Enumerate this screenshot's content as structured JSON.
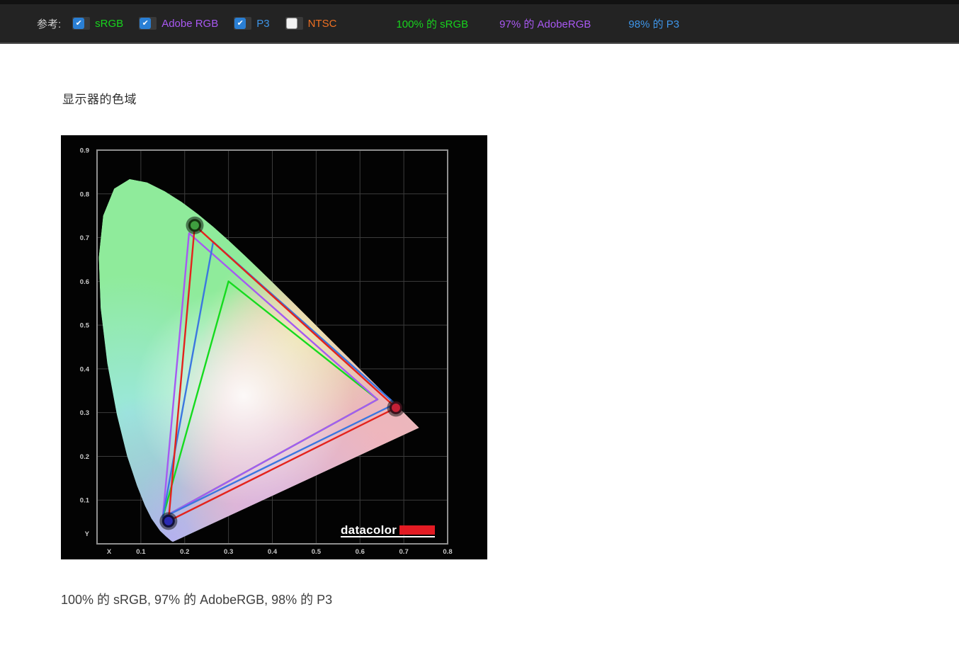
{
  "toolbar": {
    "label": "参考:",
    "checkboxes": [
      {
        "label": "sRGB",
        "checked": true,
        "color": "#17d41d"
      },
      {
        "label": "Adobe RGB",
        "checked": true,
        "color": "#a958f2"
      },
      {
        "label": "P3",
        "checked": true,
        "color": "#3e95e8"
      },
      {
        "label": "NTSC",
        "checked": false,
        "color": "#ee7022"
      }
    ],
    "summaries": [
      {
        "text": "100% 的 sRGB",
        "color": "#17d41d"
      },
      {
        "text": "97% 的 AdobeRGB",
        "color": "#a958f2"
      },
      {
        "text": "98% 的 P3",
        "color": "#3e95e8"
      }
    ]
  },
  "main": {
    "title": "显示器的色域",
    "caption": "100% 的 sRGB, 97% 的 AdobeRGB, 98% 的 P3"
  },
  "chart_data": {
    "type": "scatter",
    "subtype": "cie-1931-chromaticity-diagram",
    "title": "显示器的色域",
    "xlabel": "X",
    "ylabel": "Y",
    "xlim": [
      0,
      0.8
    ],
    "ylim": [
      0,
      0.9
    ],
    "xticks": [
      "0.1",
      "0.2",
      "0.3",
      "0.4",
      "0.5",
      "0.6",
      "0.7",
      "0.8"
    ],
    "yticks": [
      "0.1",
      "0.2",
      "0.3",
      "0.4",
      "0.5",
      "0.6",
      "0.7",
      "0.8",
      "0.9"
    ],
    "grid": true,
    "legend_position": "none",
    "brand": "datacolor",
    "brand_accent_color": "#e31b23",
    "series": [
      {
        "name": "sRGB",
        "color": "#15db1e",
        "coverage": "100%",
        "points": [
          [
            0.64,
            0.33
          ],
          [
            0.3,
            0.6
          ],
          [
            0.15,
            0.06
          ]
        ]
      },
      {
        "name": "Adobe RGB",
        "color": "#a55af2",
        "coverage": "97%",
        "points": [
          [
            0.64,
            0.33
          ],
          [
            0.21,
            0.71
          ],
          [
            0.15,
            0.06
          ]
        ]
      },
      {
        "name": "P3",
        "color": "#3b77e0",
        "coverage": "98%",
        "points": [
          [
            0.68,
            0.32
          ],
          [
            0.265,
            0.69
          ],
          [
            0.15,
            0.06
          ]
        ]
      },
      {
        "name": "显示器",
        "color": "#e3231c",
        "coverage": "",
        "points": [
          [
            0.682,
            0.311
          ],
          [
            0.223,
            0.728
          ],
          [
            0.163,
            0.052
          ]
        ]
      }
    ],
    "markers": [
      {
        "xy": [
          0.223,
          0.728
        ],
        "fill": "#3f9e3f",
        "ring": "#14330f",
        "name": "green-primary"
      },
      {
        "xy": [
          0.682,
          0.311
        ],
        "fill": "#c32035",
        "ring": "#38101a",
        "name": "red-primary"
      },
      {
        "xy": [
          0.163,
          0.052
        ],
        "fill": "#2a2ab2",
        "ring": "#10103a",
        "name": "blue-primary"
      }
    ],
    "spectral_locus": [
      [
        0.1741,
        0.005
      ],
      [
        0.1726,
        0.0048
      ],
      [
        0.1714,
        0.0051
      ],
      [
        0.1689,
        0.0069
      ],
      [
        0.1644,
        0.0109
      ],
      [
        0.1566,
        0.0177
      ],
      [
        0.144,
        0.0297
      ],
      [
        0.1241,
        0.0578
      ],
      [
        0.1096,
        0.0868
      ],
      [
        0.0913,
        0.1327
      ],
      [
        0.0687,
        0.2007
      ],
      [
        0.0454,
        0.295
      ],
      [
        0.0235,
        0.4127
      ],
      [
        0.0082,
        0.5384
      ],
      [
        0.0039,
        0.6548
      ],
      [
        0.0139,
        0.7502
      ],
      [
        0.0389,
        0.812
      ],
      [
        0.0743,
        0.8338
      ],
      [
        0.1142,
        0.8262
      ],
      [
        0.1547,
        0.8059
      ],
      [
        0.1929,
        0.7816
      ],
      [
        0.2296,
        0.7543
      ],
      [
        0.2658,
        0.7243
      ],
      [
        0.3016,
        0.6923
      ],
      [
        0.3373,
        0.6589
      ],
      [
        0.3731,
        0.6245
      ],
      [
        0.4087,
        0.5896
      ],
      [
        0.4441,
        0.5547
      ],
      [
        0.4788,
        0.5202
      ],
      [
        0.5125,
        0.4866
      ],
      [
        0.5448,
        0.4544
      ],
      [
        0.5752,
        0.4242
      ],
      [
        0.6029,
        0.3965
      ],
      [
        0.627,
        0.3725
      ],
      [
        0.6482,
        0.3514
      ],
      [
        0.6658,
        0.334
      ],
      [
        0.6915,
        0.3083
      ],
      [
        0.7079,
        0.292
      ],
      [
        0.719,
        0.2809
      ],
      [
        0.726,
        0.274
      ],
      [
        0.7347,
        0.2653
      ]
    ]
  }
}
